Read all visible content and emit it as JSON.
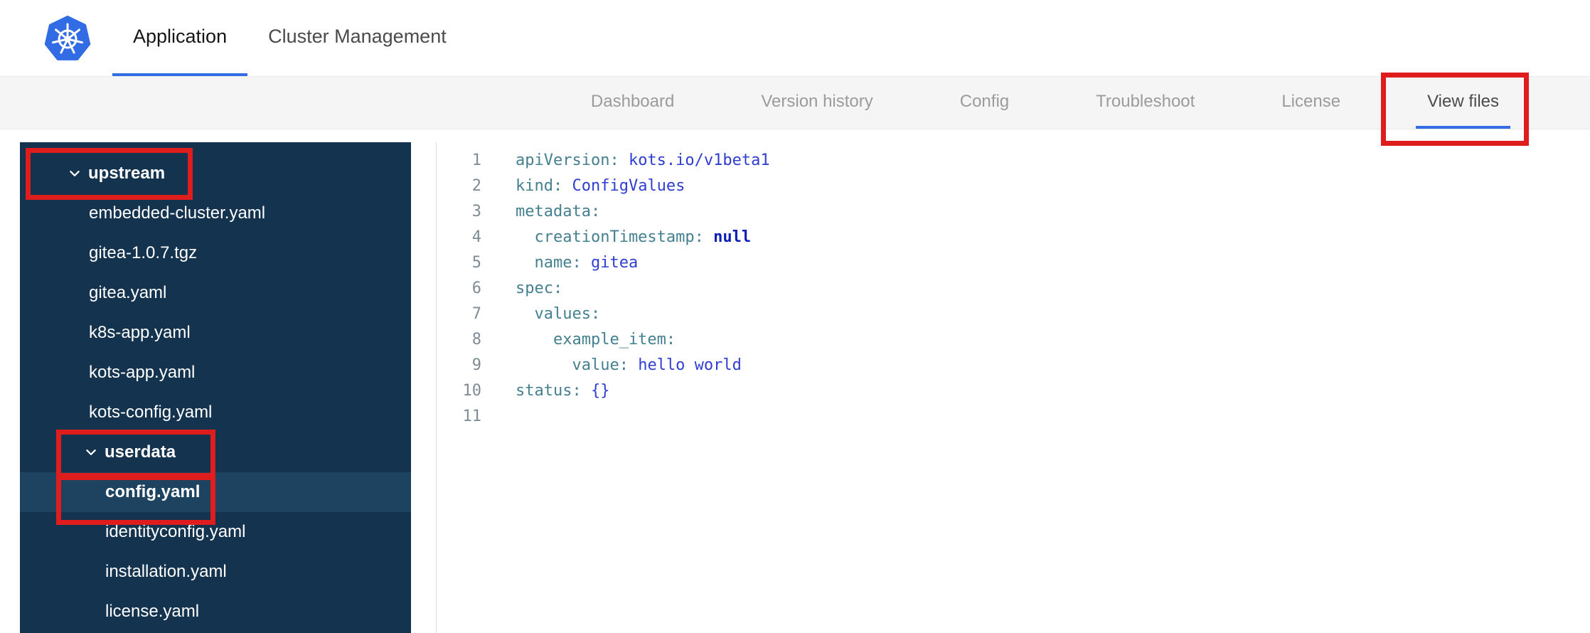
{
  "header": {
    "logo": "kubernetes-logo",
    "tabs": [
      {
        "label": "Application",
        "active": true
      },
      {
        "label": "Cluster Management",
        "active": false
      }
    ]
  },
  "subnav": {
    "items": [
      {
        "label": "Dashboard",
        "active": false
      },
      {
        "label": "Version history",
        "active": false
      },
      {
        "label": "Config",
        "active": false
      },
      {
        "label": "Troubleshoot",
        "active": false
      },
      {
        "label": "License",
        "active": false
      },
      {
        "label": "View files",
        "active": true
      }
    ]
  },
  "file_tree": {
    "items": [
      {
        "type": "folder",
        "label": "upstream",
        "level": 0,
        "expanded": true
      },
      {
        "type": "file",
        "label": "embedded-cluster.yaml",
        "level": 1
      },
      {
        "type": "file",
        "label": "gitea-1.0.7.tgz",
        "level": 1
      },
      {
        "type": "file",
        "label": "gitea.yaml",
        "level": 1
      },
      {
        "type": "file",
        "label": "k8s-app.yaml",
        "level": 1
      },
      {
        "type": "file",
        "label": "kots-app.yaml",
        "level": 1
      },
      {
        "type": "file",
        "label": "kots-config.yaml",
        "level": 1
      },
      {
        "type": "folder",
        "label": "userdata",
        "level": 1,
        "expanded": true
      },
      {
        "type": "file",
        "label": "config.yaml",
        "level": 2,
        "selected": true
      },
      {
        "type": "file",
        "label": "identityconfig.yaml",
        "level": 2
      },
      {
        "type": "file",
        "label": "installation.yaml",
        "level": 2
      },
      {
        "type": "file",
        "label": "license.yaml",
        "level": 2
      }
    ]
  },
  "editor": {
    "lines": [
      {
        "n": "1",
        "tokens": [
          {
            "t": "key",
            "v": "apiVersion:"
          },
          {
            "t": "val",
            "v": " kots.io/v1beta1"
          }
        ]
      },
      {
        "n": "2",
        "tokens": [
          {
            "t": "key",
            "v": "kind:"
          },
          {
            "t": "val",
            "v": " ConfigValues"
          }
        ]
      },
      {
        "n": "3",
        "tokens": [
          {
            "t": "key",
            "v": "metadata:"
          }
        ]
      },
      {
        "n": "4",
        "tokens": [
          {
            "t": "key",
            "v": "  creationTimestamp:"
          },
          {
            "t": "const",
            "v": " null"
          }
        ]
      },
      {
        "n": "5",
        "tokens": [
          {
            "t": "key",
            "v": "  name:"
          },
          {
            "t": "val",
            "v": " gitea"
          }
        ]
      },
      {
        "n": "6",
        "tokens": [
          {
            "t": "key",
            "v": "spec:"
          }
        ]
      },
      {
        "n": "7",
        "tokens": [
          {
            "t": "key",
            "v": "  values:"
          }
        ]
      },
      {
        "n": "8",
        "tokens": [
          {
            "t": "key",
            "v": "    example_item:"
          }
        ]
      },
      {
        "n": "9",
        "tokens": [
          {
            "t": "key",
            "v": "      value:"
          },
          {
            "t": "val",
            "v": " hello world"
          }
        ]
      },
      {
        "n": "10",
        "tokens": [
          {
            "t": "key",
            "v": "status:"
          },
          {
            "t": "val",
            "v": " {}"
          }
        ]
      },
      {
        "n": "11",
        "tokens": []
      }
    ]
  },
  "annotations": [
    {
      "target": "upstream-folder"
    },
    {
      "target": "userdata-folder"
    },
    {
      "target": "config-yaml-file"
    },
    {
      "target": "view-files-tab"
    }
  ],
  "colors": {
    "accent_blue": "#326de5",
    "kubernetes_blue": "#326ce5",
    "annotation_red": "#e01d1d",
    "sidebar_bg": "#14334e",
    "sidebar_selected": "#1d4360",
    "nav_text": "#9b9b9b",
    "nav_text_active": "#4a4a4a",
    "code_key": "#44808f",
    "code_value": "#2f3ed1",
    "code_constant": "#0a1fb4",
    "line_number": "#7e8c96"
  }
}
